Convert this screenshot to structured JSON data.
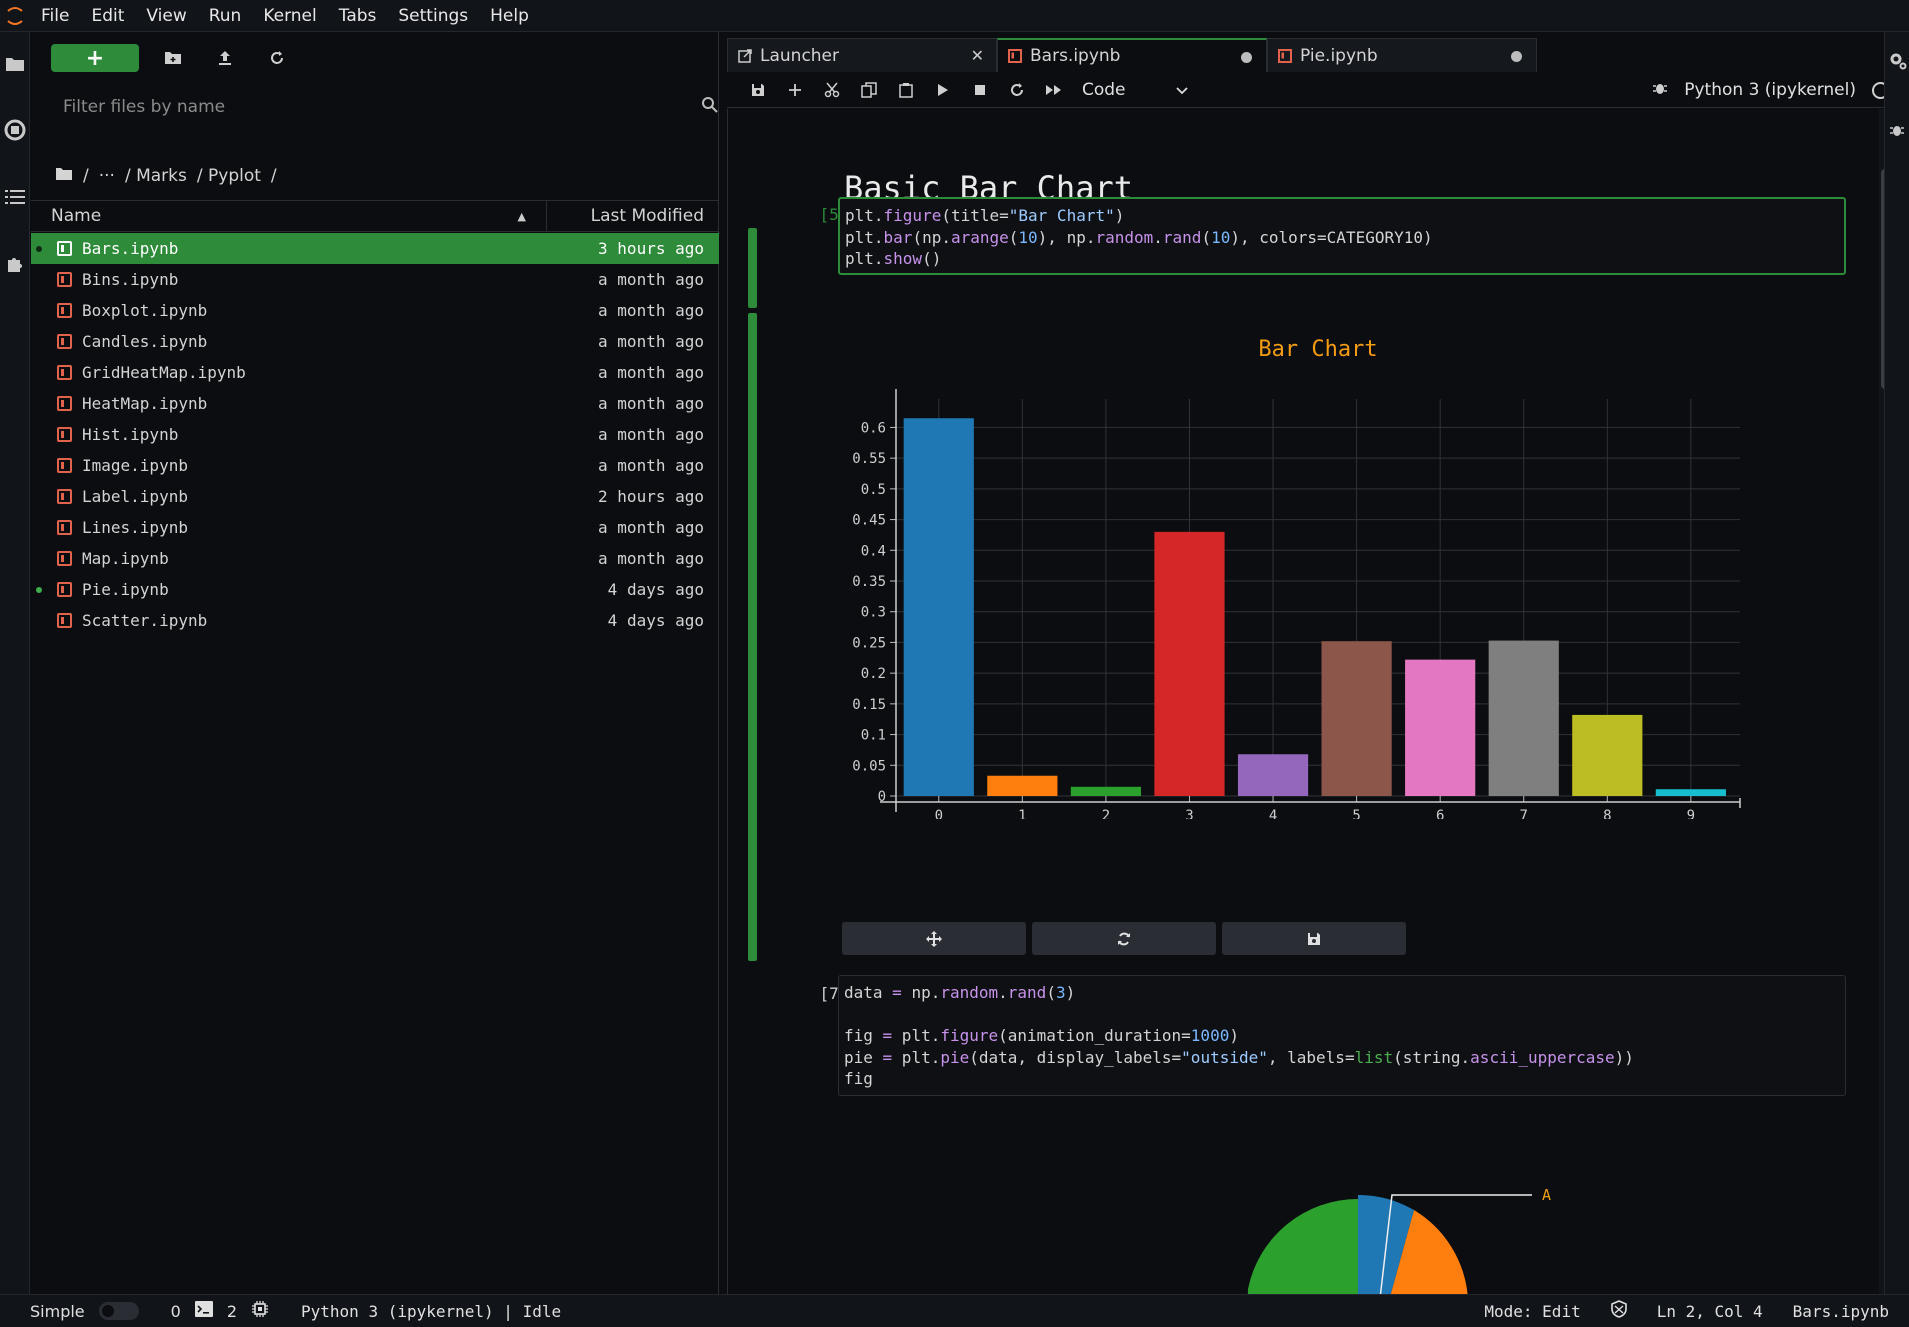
{
  "menubar": {
    "items": [
      "File",
      "Edit",
      "View",
      "Run",
      "Kernel",
      "Tabs",
      "Settings",
      "Help"
    ]
  },
  "filebrowser": {
    "new_label": "+",
    "filter_placeholder": "Filter files by name",
    "breadcrumb": [
      "/",
      "···",
      "/ Marks",
      "/ Pyplot",
      "/"
    ],
    "columns": {
      "name": "Name",
      "modified": "Last Modified"
    },
    "files": [
      {
        "name": "Bars.ipynb",
        "modified": "3 hours ago",
        "selected": true,
        "running": true
      },
      {
        "name": "Bins.ipynb",
        "modified": "a month ago"
      },
      {
        "name": "Boxplot.ipynb",
        "modified": "a month ago"
      },
      {
        "name": "Candles.ipynb",
        "modified": "a month ago"
      },
      {
        "name": "GridHeatMap.ipynb",
        "modified": "a month ago"
      },
      {
        "name": "HeatMap.ipynb",
        "modified": "a month ago"
      },
      {
        "name": "Hist.ipynb",
        "modified": "a month ago"
      },
      {
        "name": "Image.ipynb",
        "modified": "a month ago"
      },
      {
        "name": "Label.ipynb",
        "modified": "2 hours ago"
      },
      {
        "name": "Lines.ipynb",
        "modified": "a month ago"
      },
      {
        "name": "Map.ipynb",
        "modified": "a month ago"
      },
      {
        "name": "Pie.ipynb",
        "modified": "4 days ago",
        "running": true
      },
      {
        "name": "Scatter.ipynb",
        "modified": "4 days ago"
      }
    ]
  },
  "tabs": [
    {
      "label": "Launcher"
    },
    {
      "label": "Bars.ipynb"
    },
    {
      "label": "Pie.ipynb"
    }
  ],
  "notebook": {
    "cell_type": "Code",
    "kernel": "Python 3 (ipykernel)",
    "heading": "Basic Bar Chart",
    "cell1_prompt": "[5]:",
    "cell2_prompt": "[7]:"
  },
  "chart_data": {
    "type": "bar",
    "title": "Bar Chart",
    "categories": [
      "0",
      "1",
      "2",
      "3",
      "4",
      "5",
      "6",
      "7",
      "8",
      "9"
    ],
    "values": [
      0.615,
      0.033,
      0.015,
      0.43,
      0.068,
      0.252,
      0.222,
      0.253,
      0.132,
      0.011
    ],
    "colors": [
      "#1f77b4",
      "#ff7f0e",
      "#2ca02c",
      "#d62728",
      "#9467bd",
      "#8c564b",
      "#e377c2",
      "#7f7f7f",
      "#bcbd22",
      "#17becf"
    ],
    "ylim": [
      0,
      0.63
    ],
    "yticks": [
      "0",
      "0.05",
      "0.1",
      "0.15",
      "0.2",
      "0.25",
      "0.3",
      "0.35",
      "0.4",
      "0.45",
      "0.5",
      "0.55",
      "0.6"
    ],
    "grid": true,
    "title_color": "#f39c12"
  },
  "pie_label": "A",
  "statusbar": {
    "mode_label": "Simple",
    "count_a": "0",
    "count_b": "2",
    "kernel_status": "Python 3 (ipykernel) | Idle",
    "edit_mode": "Mode: Edit",
    "position": "Ln 2, Col 4",
    "filename": "Bars.ipynb"
  }
}
